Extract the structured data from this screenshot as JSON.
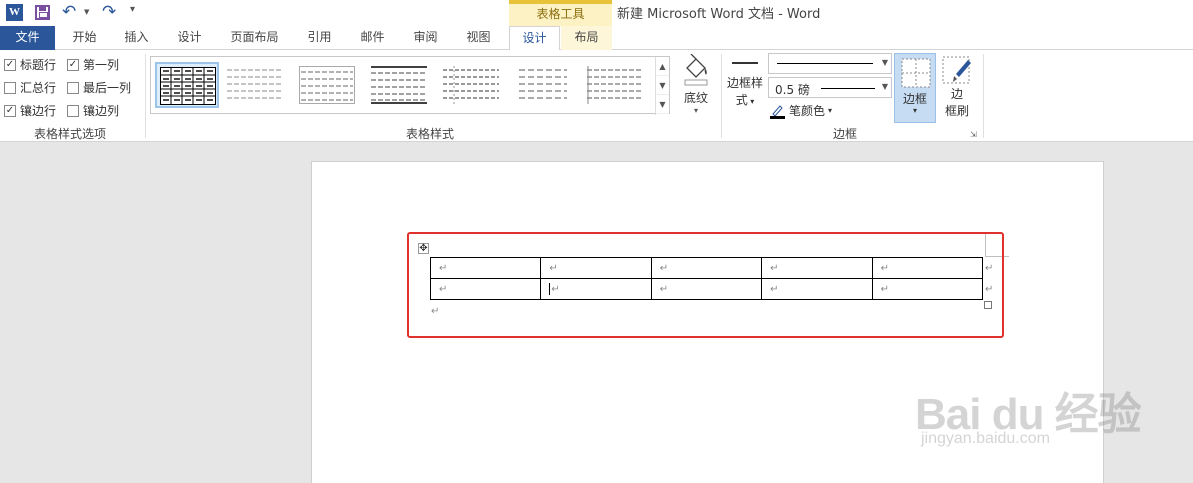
{
  "title_bar": {
    "document_title": "新建 Microsoft Word 文档 - Word",
    "context_group": "表格工具"
  },
  "quick_access": {
    "icons": [
      "word-icon",
      "save-icon",
      "undo-icon",
      "redo-icon",
      "customize-icon"
    ]
  },
  "tabs": [
    {
      "label": "文件",
      "type": "file"
    },
    {
      "label": "开始"
    },
    {
      "label": "插入"
    },
    {
      "label": "设计"
    },
    {
      "label": "页面布局"
    },
    {
      "label": "引用"
    },
    {
      "label": "邮件"
    },
    {
      "label": "审阅"
    },
    {
      "label": "视图"
    },
    {
      "label": "设计",
      "active": true,
      "context": true
    },
    {
      "label": "布局",
      "context": true
    }
  ],
  "style_options": {
    "label": "表格样式选项",
    "checkboxes": [
      {
        "label": "标题行",
        "checked": true
      },
      {
        "label": "第一列",
        "checked": true
      },
      {
        "label": "汇总行",
        "checked": false
      },
      {
        "label": "最后一列",
        "checked": false
      },
      {
        "label": "镶边行",
        "checked": true
      },
      {
        "label": "镶边列",
        "checked": false
      }
    ]
  },
  "table_styles": {
    "label": "表格样式",
    "shading_label": "底纹"
  },
  "borders": {
    "label": "边框",
    "border_styles_label_1": "边框样",
    "border_styles_label_2": "式",
    "weight_value": "0.5 磅",
    "pen_color_label": "笔颜色",
    "borders_button_label": "边框",
    "painter_label_1": "边",
    "painter_label_2": "框刷"
  },
  "document": {
    "table": {
      "rows": 2,
      "cols": 5,
      "cell_mark": "↵"
    }
  },
  "watermark": {
    "brand": "Bai du 经验",
    "url": "jingyan.baidu.com"
  },
  "colors": {
    "accent": "#2b579a",
    "context_tab": "#fdf2c4",
    "highlight_frame": "#e0312c"
  }
}
